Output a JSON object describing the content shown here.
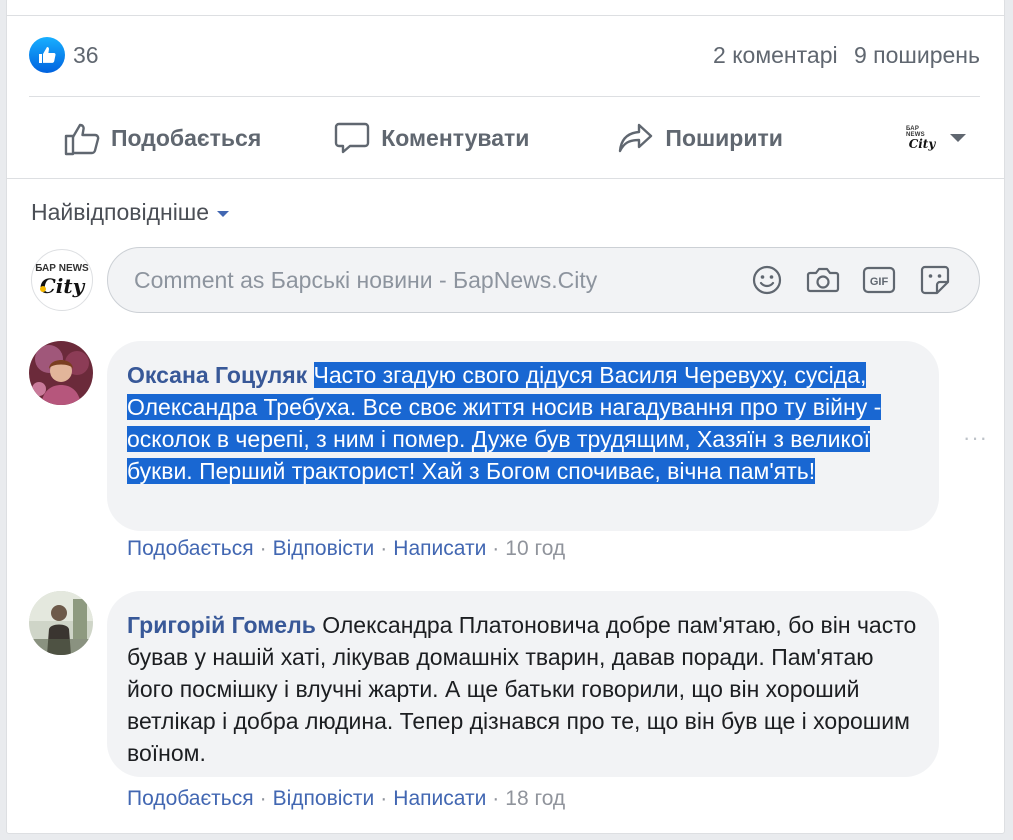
{
  "reactions": {
    "count": "36",
    "icon": "thumbs-up-icon",
    "color": "#1877f2"
  },
  "counts": {
    "comments": "2 коментарі",
    "shares": "9 поширень"
  },
  "actions": {
    "like": "Подобається",
    "comment": "Коментувати",
    "share": "Поширити"
  },
  "page_logo": {
    "line1": "БАР NEWS",
    "line2": "City"
  },
  "sort": {
    "label": "Найвідповідніше"
  },
  "composer": {
    "placeholder": "Comment as Барські новини - БарNews.City",
    "icons": [
      "emoji-icon",
      "camera-icon",
      "gif-icon",
      "sticker-icon"
    ]
  },
  "comments": [
    {
      "author": "Оксана Гоцуляк",
      "text": "Часто згадую свого дідуся Василя Черевуху, сусіда, Олександра Требуха. Все своє життя носив нагадування про ту війну - осколок в черепі, з ним і помер. Дуже був трудящим, Хазяїн з великої букви. Перший тракторист! Хай з Богом спочиває, вічна пам'ять!",
      "like": "Подобається",
      "reply": "Відповісти",
      "message": "Написати",
      "time": "10 год"
    },
    {
      "author": "Григорій Гомель",
      "text": "Олександра Платоновича добре пам'ятаю, бо він часто бував у нашій хаті, лікував домашніх тварин, давав поради. Пам'ятаю його посмішку і влучні жарти. А ще батьки говорили, що він хороший ветлікар і добра людина. Тепер дізнався про те, що він був ще і хорошим воїном.",
      "like": "Подобається",
      "reply": "Відповісти",
      "message": "Написати",
      "time": "18 год"
    }
  ],
  "colors": {
    "link": "#385898",
    "action": "#4267b2",
    "highlight": "#1967d2",
    "bubble": "#f2f3f5"
  }
}
